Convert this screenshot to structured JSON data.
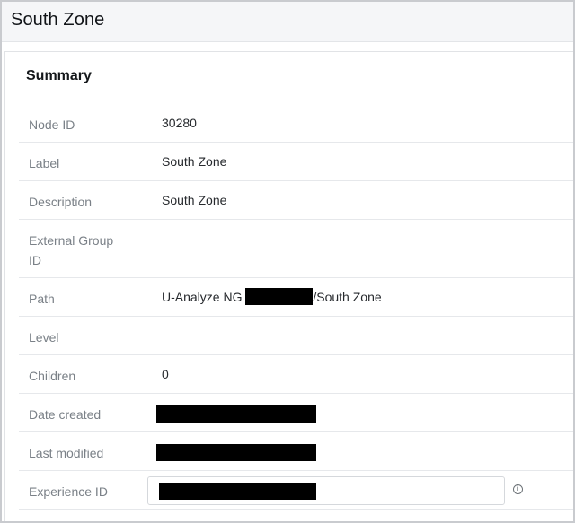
{
  "header": {
    "title": "South Zone"
  },
  "summary": {
    "title": "Summary",
    "rows": {
      "node_id": {
        "label": "Node ID",
        "value": "30280"
      },
      "label": {
        "label": "Label",
        "value": "South Zone"
      },
      "description": {
        "label": "Description",
        "value": "South Zone"
      },
      "external_group_id": {
        "label": "External Group ID",
        "value": ""
      },
      "path": {
        "label": "Path",
        "value_prefix": "U-Analyze NG ",
        "value_suffix": "/South Zone"
      },
      "level": {
        "label": "Level",
        "value": ""
      },
      "children": {
        "label": "Children",
        "value": "0"
      },
      "date_created": {
        "label": "Date created"
      },
      "last_modified": {
        "label": "Last modified"
      },
      "experience_id": {
        "label": "Experience ID"
      }
    }
  },
  "icons": {
    "info": "info-circle-icon"
  },
  "colors": {
    "header_bg": "#f5f6f8",
    "label_text": "#7a8087",
    "value_text": "#26292d",
    "redaction": "#000000"
  }
}
